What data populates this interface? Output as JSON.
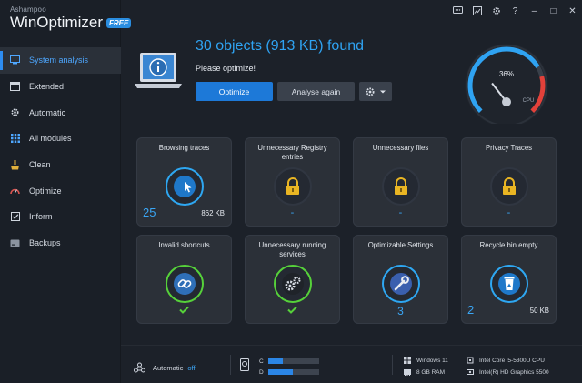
{
  "app": {
    "vendor": "Ashampoo",
    "name": "WinOptimizer",
    "edition": "FREE"
  },
  "titlebar": {
    "icons": [
      "chat-icon",
      "image-icon",
      "gear-icon",
      "help-icon",
      "minimize-icon",
      "maximize-icon",
      "close-icon"
    ],
    "labels": {
      "help": "?",
      "minimize": "–",
      "maximize": "□",
      "close": "✕"
    }
  },
  "sidebar": {
    "items": [
      {
        "label": "System analysis",
        "icon": "monitor-icon",
        "active": true
      },
      {
        "label": "Extended",
        "icon": "window-icon"
      },
      {
        "label": "Automatic",
        "icon": "gear-icon"
      },
      {
        "label": "All modules",
        "icon": "grid-icon"
      },
      {
        "label": "Clean",
        "icon": "broom-icon"
      },
      {
        "label": "Optimize",
        "icon": "speedometer-icon"
      },
      {
        "label": "Inform",
        "icon": "checkbox-icon"
      },
      {
        "label": "Backups",
        "icon": "drive-icon"
      }
    ]
  },
  "header": {
    "found": "30 objects (913 KB) found",
    "message": "Please optimize!",
    "optimize_label": "Optimize",
    "analyse_label": "Analyse again",
    "gauge": {
      "value_label": "36%",
      "caption": "CPU",
      "value": 0.36
    }
  },
  "tiles": [
    {
      "title": "Browsing traces",
      "count": "25",
      "size": "862 KB",
      "state": "cursor",
      "color": "#2ea7f2"
    },
    {
      "title": "Unnecessary Registry entries",
      "dash": "-",
      "state": "lock"
    },
    {
      "title": "Unnecessary files",
      "dash": "-",
      "state": "lock"
    },
    {
      "title": "Privacy Traces",
      "dash": "-",
      "state": "lock"
    },
    {
      "title": "Invalid shortcuts",
      "state": "link",
      "status": "check",
      "color": "#56d13a"
    },
    {
      "title": "Unnecessary running services",
      "state": "gears",
      "status": "check",
      "color": "#56d13a"
    },
    {
      "title": "Optimizable Settings",
      "center": "3",
      "state": "wrench",
      "color": "#2ea7f2"
    },
    {
      "title": "Recycle bin empty",
      "count": "2",
      "size": "50 KB",
      "state": "recycle",
      "color": "#2ea7f2"
    }
  ],
  "footer": {
    "automatic_label": "Automatic",
    "automatic_state": "off",
    "drives": [
      {
        "label": "C",
        "usage": 0.28
      },
      {
        "label": "D",
        "usage": 0.48
      }
    ],
    "os": "Windows 11",
    "ram": "8 GB RAM",
    "cpu": "Intel Core i5-5300U CPU",
    "gpu": "Intel(R) HD Graphics 5500"
  },
  "colors": {
    "accent": "#2d8cf0",
    "green": "#56d13a",
    "lock": "#e9b523",
    "background": "#1c2129"
  }
}
